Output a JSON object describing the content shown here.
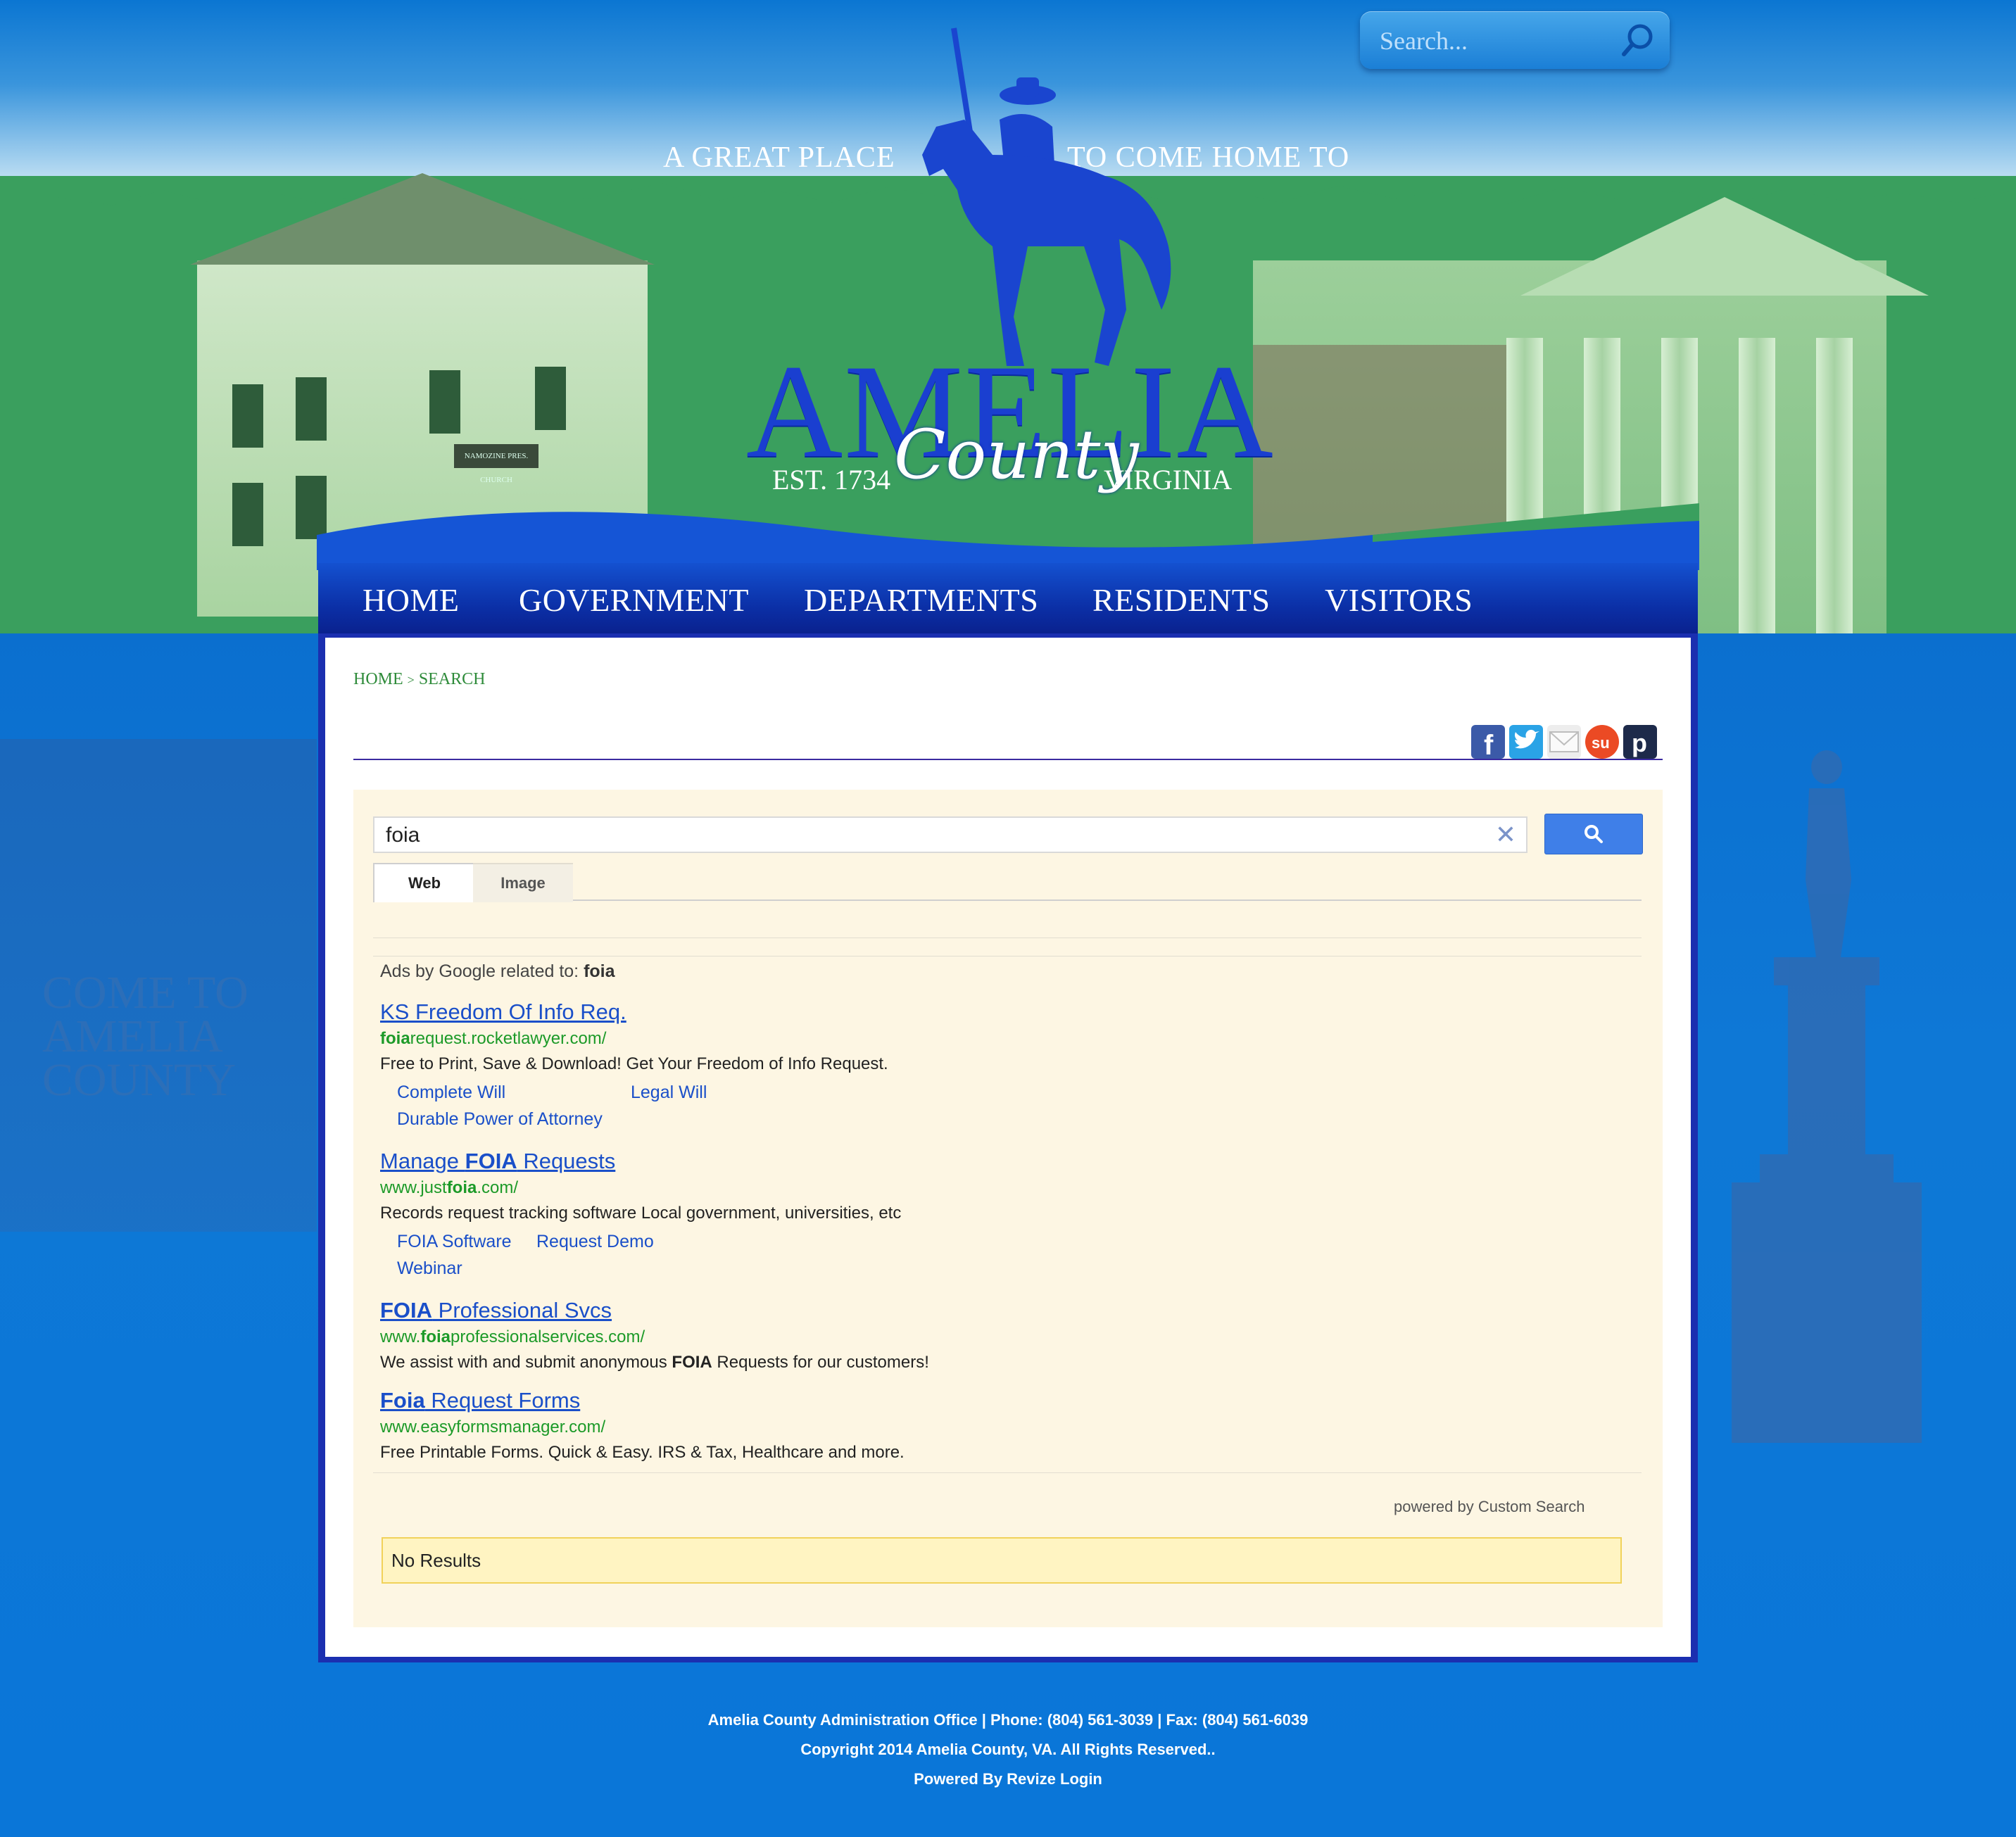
{
  "header": {
    "tagline_left": "A GREAT PLACE",
    "tagline_right": "TO COME HOME TO",
    "logo_main": "AMELIA",
    "logo_script": "County",
    "logo_est": "EST. 1734",
    "logo_state": "VIRGINIA",
    "search_placeholder": "Search...",
    "left_building_sign": "NAMOZINE PRES. CHURCH"
  },
  "nav": {
    "items": [
      "HOME",
      "GOVERNMENT",
      "DEPARTMENTS",
      "RESIDENTS",
      "VISITORS"
    ]
  },
  "breadcrumb": {
    "home": "HOME",
    "separator": ">",
    "current": "SEARCH"
  },
  "share_icons": [
    "facebook-icon",
    "twitter-icon",
    "email-icon",
    "stumbleupon-icon",
    "pinterest-icon"
  ],
  "search": {
    "query": "foia",
    "tabs": [
      "Web",
      "Image"
    ],
    "ads_label": "Ads by Google related to:",
    "ads_term": "foia",
    "powered_by": "powered by",
    "powered_brand": "Custom Search",
    "no_results": "No Results"
  },
  "ads": [
    {
      "title_parts": [
        [
          "KS Freedom Of Info Req.",
          false
        ]
      ],
      "url_parts": [
        [
          "foia",
          true
        ],
        [
          "request.rocketlawyer.com/",
          false
        ]
      ],
      "desc_parts": [
        [
          "Free to Print, Save & Download! Get Your Freedom of Info Request.",
          false
        ]
      ],
      "sitelinks": [
        "Complete Will",
        "Legal Will",
        "Durable Power of Attorney"
      ]
    },
    {
      "title_parts": [
        [
          "Manage ",
          false
        ],
        [
          "FOIA",
          true
        ],
        [
          " Requests",
          false
        ]
      ],
      "url_parts": [
        [
          "www.just",
          false
        ],
        [
          "foia",
          true
        ],
        [
          ".com/",
          false
        ]
      ],
      "desc_parts": [
        [
          "Records request tracking software Local government, universities, etc",
          false
        ]
      ],
      "sitelinks": [
        "FOIA Software",
        "Request Demo",
        "Webinar"
      ]
    },
    {
      "title_parts": [
        [
          "FOIA",
          true
        ],
        [
          " Professional Svcs",
          false
        ]
      ],
      "url_parts": [
        [
          "www.",
          false
        ],
        [
          "foia",
          true
        ],
        [
          "professionalservices.com/",
          false
        ]
      ],
      "desc_parts": [
        [
          "We assist with and submit anonymous ",
          false
        ],
        [
          "FOIA",
          true
        ],
        [
          " Requests for our customers!",
          false
        ]
      ],
      "sitelinks": []
    },
    {
      "title_parts": [
        [
          "Foia",
          true
        ],
        [
          " Request Forms",
          false
        ]
      ],
      "url_parts": [
        [
          "www.easyformsmanager.com/",
          false
        ]
      ],
      "desc_parts": [
        [
          "Free Printable Forms. Quick & Easy. IRS & Tax, Healthcare and more.",
          false
        ]
      ],
      "sitelinks": []
    }
  ],
  "footer": {
    "line1": "Amelia County Administration Office | Phone: (804) 561-3039 | Fax: (804) 561-6039",
    "line2": "Copyright 2014 Amelia County, VA. All Rights Reserved..",
    "line3_prefix": "Powered By Revize",
    "line3_login": "Login"
  },
  "background_text": "COME TO AMELIA COUNTY",
  "colors": {
    "nav_blue": "#0b2fa6",
    "sky_blue": "#0b76d2",
    "hill_green": "#3a9f5e",
    "link_blue": "#1a4fc9",
    "url_green": "#1c9a28",
    "panel_cream": "#fdf6e3"
  }
}
